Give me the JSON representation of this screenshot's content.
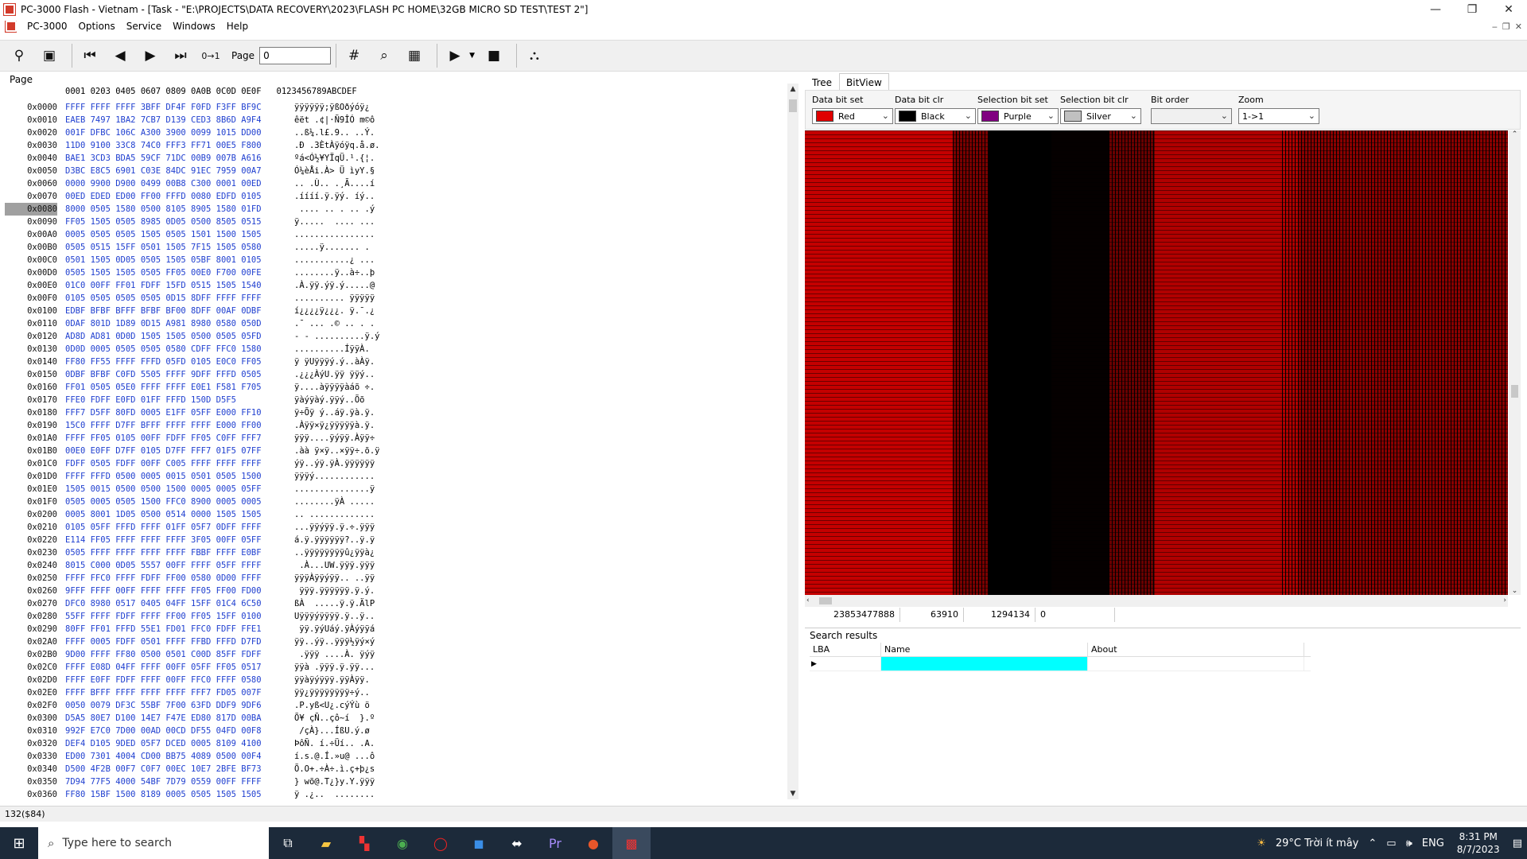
{
  "window": {
    "title": "PC-3000 Flash - Vietnam - [Task - \"E:\\PROJECTS\\DATA RECOVERY\\2023\\FLASH PC HOME\\32GB MICRO SD TEST\\TEST 2\"]"
  },
  "menu": {
    "items": [
      "PC-3000",
      "Options",
      "Service",
      "Windows",
      "Help"
    ]
  },
  "toolbar": {
    "page_label": "Page",
    "page_value": "0"
  },
  "page_panel": {
    "label": "Page",
    "header": "0001 0203 0405 0607 0809 0A0B 0C0D 0E0F   0123456789ABCDEF"
  },
  "rows": [
    {
      "addr": "0x0000",
      "hex": "FFFF FFFF FFFF 3BFF DF4F F0FD F3FF BF9C",
      "ascii": "ÿÿÿÿÿÿ;ÿßOðýóÿ¿"
    },
    {
      "addr": "0x0010",
      "hex": "EAEB 7497 1BA2 7CB7 D139 CED3 8B6D A9F4",
      "ascii": "êët .¢|·Ñ9ÎÓ m©ô"
    },
    {
      "addr": "0x0020",
      "hex": "001F DFBC 106C A300 3900 0099 1015 DD00",
      "ascii": "..ß¼.l£.9.. ..Ý."
    },
    {
      "addr": "0x0030",
      "hex": "11D0 9100 33C8 74C0 FFF3 FF71 00E5 F800",
      "ascii": ".Ð .3ÈtÀÿóÿq.å.ø."
    },
    {
      "addr": "0x0040",
      "hex": "BAE1 3CD3 BDA5 59CF 71DC 00B9 007B A616",
      "ascii": "ºá<Ó½¥YÏqÜ.¹.{¦."
    },
    {
      "addr": "0x0050",
      "hex": "D3BC E8C5 6901 C03E 84DC 91EC 7959 00A7",
      "ascii": "Ó¼èÅi.À> Ü ìyY.§"
    },
    {
      "addr": "0x0060",
      "hex": "0000 9900 D900 0499 00B8 C300 0001 00ED",
      "ascii": ".. .Ù.. .¸Ã....í"
    },
    {
      "addr": "0x0070",
      "hex": "00ED EDED ED00 FF00 FFFD 0080 EDFD 0105",
      "ascii": ".íííí.ÿ.ÿý. íý.."
    },
    {
      "addr": "0x0080",
      "hex": "8000 0505 1580 0500 8105 8905 1580 01FD",
      "ascii": " .... .. . .. .ý",
      "sel": true
    },
    {
      "addr": "0x0090",
      "hex": "FF05 1505 0505 8985 0D05 0500 8505 0515",
      "ascii": "ÿ.....  .... ..."
    },
    {
      "addr": "0x00A0",
      "hex": "0005 0505 0505 1505 0505 1501 1500 1505",
      "ascii": "................"
    },
    {
      "addr": "0x00B0",
      "hex": "0505 0515 15FF 0501 1505 7F15 1505 0580",
      "ascii": ".....ÿ....... ."
    },
    {
      "addr": "0x00C0",
      "hex": "0501 1505 0D05 0505 1505 05BF 8001 0105",
      "ascii": "...........¿ ..."
    },
    {
      "addr": "0x00D0",
      "hex": "0505 1505 1505 0505 FF05 00E0 F700 00FE",
      "ascii": "........ÿ..à÷..þ"
    },
    {
      "addr": "0x00E0",
      "hex": "01C0 00FF FF01 FDFF 15FD 0515 1505 1540",
      "ascii": ".À.ÿÿ.ýÿ.ý.....@"
    },
    {
      "addr": "0x00F0",
      "hex": "0105 0505 0505 0505 0D15 8DFF FFFF FFFF",
      "ascii": ".......... ÿÿÿÿÿ"
    },
    {
      "addr": "0x0100",
      "hex": "EDBF BFBF BFFF BFBF BF00 8DFF 00AF 0DBF",
      "ascii": "í¿¿¿¿ÿ¿¿¿. ÿ.¯.¿"
    },
    {
      "addr": "0x0110",
      "hex": "0DAF 801D 1D89 0D15 A981 8980 0580 050D",
      "ascii": ".¯ ... .© .. . ."
    },
    {
      "addr": "0x0120",
      "hex": "AD8D AD81 0D0D 1505 1505 0500 0505 05FD",
      "ascii": "- - ..........ÿ.ý"
    },
    {
      "addr": "0x0130",
      "hex": "0D0D 0005 0505 0505 0580 CDFF FFC0 1580",
      "ascii": "..........ÍÿÿÀ. "
    },
    {
      "addr": "0x0140",
      "hex": "FF80 FF55 FFFF FFFD 05FD 0105 E0C0 FF05",
      "ascii": "ÿ ÿUÿÿÿý.ý..àÀÿ."
    },
    {
      "addr": "0x0150",
      "hex": "0DBF BFBF C0FD 5505 FFFF 9DFF FFFD 0505",
      "ascii": ".¿¿¿ÀýU.ÿÿ ÿÿý.."
    },
    {
      "addr": "0x0160",
      "hex": "FF01 0505 05E0 FFFF FFFF E0E1 F581 F705",
      "ascii": "ÿ....àÿÿÿÿàáõ ÷."
    },
    {
      "addr": "0x0170",
      "hex": "FFE0 FDFF E0FD 01FF FFFD 150D D5F5 ",
      "ascii": "ÿàýÿàý.ÿÿý..Õõ"
    },
    {
      "addr": "0x0180",
      "hex": "FFF7 D5FF 80FD 0005 E1FF 05FF E000 FF10",
      "ascii": "ÿ÷Õÿ ý..áÿ.ÿà.ÿ."
    },
    {
      "addr": "0x0190",
      "hex": "15C0 FFFF D7FF BFFF FFFF FFFF E000 FF00",
      "ascii": ".Àÿÿ×ÿ¿ÿÿÿÿÿà.ÿ."
    },
    {
      "addr": "0x01A0",
      "hex": "FFFF FF05 0105 00FF FDFF FF05 C0FF FFF7",
      "ascii": "ÿÿÿ....ÿýÿÿ.Àÿÿ÷"
    },
    {
      "addr": "0x01B0",
      "hex": "00E0 E0FF D7FF 0105 D7FF FFF7 01F5 07FF",
      "ascii": ".àà ÿ×ÿ..×ÿÿ÷.õ.ÿ"
    },
    {
      "addr": "0x01C0",
      "hex": "FDFF 0505 FDFF 00FF C005 FFFF FFFF FFFF",
      "ascii": "ýÿ..ýÿ.ÿÀ.ÿÿÿÿÿÿ"
    },
    {
      "addr": "0x01D0",
      "hex": "FFFF FFFD 0500 0005 0015 0501 0505 1500",
      "ascii": "ÿÿÿý............"
    },
    {
      "addr": "0x01E0",
      "hex": "1505 0015 0500 0500 1500 0005 0005 05FF",
      "ascii": "...............ÿ"
    },
    {
      "addr": "0x01F0",
      "hex": "0505 0005 0505 1500 FFC0 8900 0005 0005",
      "ascii": "........ÿÀ ....."
    },
    {
      "addr": "0x0200",
      "hex": "0005 8001 1D05 0500 0514 0000 1505 1505",
      "ascii": ".. ............."
    },
    {
      "addr": "0x0210",
      "hex": "0105 05FF FFFD FFFF 01FF 05F7 0DFF FFFF",
      "ascii": "...ÿÿýÿÿ.ÿ.÷.ÿÿÿ"
    },
    {
      "addr": "0x0220",
      "hex": "E114 FF05 FFFF FFFF FFFF 3F05 00FF 05FF",
      "ascii": "á.ÿ.ÿÿÿÿÿÿ?..ÿ.ÿ"
    },
    {
      "addr": "0x0230",
      "hex": "0505 FFFF FFFF FFFF FFFF FBBF FFFF E0BF",
      "ascii": "..ÿÿÿÿÿÿÿÿû¿ÿÿà¿"
    },
    {
      "addr": "0x0240",
      "hex": "8015 C000 0D05 5557 00FF FFFF 05FF FFFF",
      "ascii": " .À...UW.ÿÿÿ.ÿÿÿ"
    },
    {
      "addr": "0x0250",
      "hex": "FFFF FFC0 FFFF FDFF FF00 0580 0D00 FFFF",
      "ascii": "ÿÿÿÀÿÿýÿÿ.. ..ÿÿ"
    },
    {
      "addr": "0x0260",
      "hex": "9FFF FFFF 00FF FFFF FFFF FF05 FF00 FD00",
      "ascii": " ÿÿÿ.ÿÿÿÿÿÿ.ÿ.ý."
    },
    {
      "addr": "0x0270",
      "hex": "DFC0 8980 0517 0405 04FF 15FF 01C4 6C50",
      "ascii": "ßÀ  .....ÿ.ÿ.ÄlP"
    },
    {
      "addr": "0x0280",
      "hex": "55FF FFFF FDFF FFFF FF00 FF05 15FF 0100",
      "ascii": "Uÿÿÿýÿÿÿÿ.ÿ..ÿ.."
    },
    {
      "addr": "0x0290",
      "hex": "80FF FF01 FFFD 55E1 FD01 FFC0 FDFF FFE1",
      "ascii": " ÿÿ.ÿýUáý.ÿÀýÿÿá"
    },
    {
      "addr": "0x02A0",
      "hex": "FFFF 0005 FDFF 0501 FFFF FFBD FFFD D7FD",
      "ascii": "ÿÿ..ýÿ..ÿÿÿ½ÿý×ý"
    },
    {
      "addr": "0x02B0",
      "hex": "9D00 FFFF FF80 0500 0501 C00D 85FF FDFF",
      "ascii": " .ÿÿÿ ....À. ÿýÿ"
    },
    {
      "addr": "0x02C0",
      "hex": "FFFF E08D 04FF FFFF 00FF 05FF FF05 0517",
      "ascii": "ÿÿà .ÿÿÿ.ÿ.ÿÿ..."
    },
    {
      "addr": "0x02D0",
      "hex": "FFFF E0FF FDFF FFFF 00FF FFC0 FFFF 0580",
      "ascii": "ÿÿàÿýÿÿÿ.ÿÿÀÿÿ. "
    },
    {
      "addr": "0x02E0",
      "hex": "FFFF BFFF FFFF FFFF FFFF FFF7 FD05 007F",
      "ascii": "ÿÿ¿ÿÿÿÿÿÿÿÿ÷ý.."
    },
    {
      "addr": "0x02F0",
      "hex": "0050 0079 DF3C 55BF 7F00 63FD DDF9 9DF6",
      "ascii": ".P.yß<U¿.cýÝù ö"
    },
    {
      "addr": "0x0300",
      "hex": "D5A5 80E7 D100 14E7 F47E ED80 817D 00BA",
      "ascii": "Õ¥ çÑ..çô~í  }.º"
    },
    {
      "addr": "0x0310",
      "hex": "992F E7C0 7D00 00AD 00CD DF55 04FD 00F8",
      "ascii": " /çÀ}..­.ÍßU.ý.ø"
    },
    {
      "addr": "0x0320",
      "hex": "DEF4 D105 9DED 05F7 DCED 0005 8109 4100",
      "ascii": "ÞôÑ. í.÷Üí.. .A."
    },
    {
      "addr": "0x0330",
      "hex": "ED00 7301 4004 CD00 BB75 4089 0500 00F4",
      "ascii": "í.s.@.Í.»u@ ...ô"
    },
    {
      "addr": "0x0340",
      "hex": "D500 4F2B 00F7 C0F7 00EC 10E7 2BFE BF73",
      "ascii": "Õ.O+.÷À÷.ì.ç+þ¿s"
    },
    {
      "addr": "0x0350",
      "hex": "7D94 77F5 4000 54BF 7D79 0559 00FF FFFF",
      "ascii": "} wõ@.T¿}y.Y.ÿÿÿ"
    },
    {
      "addr": "0x0360",
      "hex": "FF80 15BF 1500 8189 0005 0505 1505 1505",
      "ascii": "ÿ .¿..  ........"
    }
  ],
  "status": {
    "text": "132($84)"
  },
  "tabs": [
    "Tree",
    "BitView"
  ],
  "bitview": {
    "data_bit_set": {
      "label": "Data bit set",
      "value": "Red",
      "color": "#e00000"
    },
    "data_bit_clr": {
      "label": "Data bit clr",
      "value": "Black",
      "color": "#000000"
    },
    "selection_bit_set": {
      "label": "Selection bit set",
      "value": "Purple",
      "color": "#800080"
    },
    "selection_bit_clr": {
      "label": "Selection bit clr",
      "value": "Silver",
      "color": "#c0c0c0"
    },
    "bit_order": {
      "label": "Bit order",
      "value": ""
    },
    "zoom": {
      "label": "Zoom",
      "value": "1->1"
    },
    "status": [
      "23853477888",
      "63910",
      "1294134",
      "0"
    ]
  },
  "search": {
    "title": "Search results",
    "columns": [
      "LBA",
      "Name",
      "About"
    ]
  },
  "taskbar": {
    "search_placeholder": "Type here to search",
    "weather": "29°C Trời ít mây",
    "lang": "ENG",
    "time": "8:31 PM",
    "date": "8/7/2023"
  }
}
